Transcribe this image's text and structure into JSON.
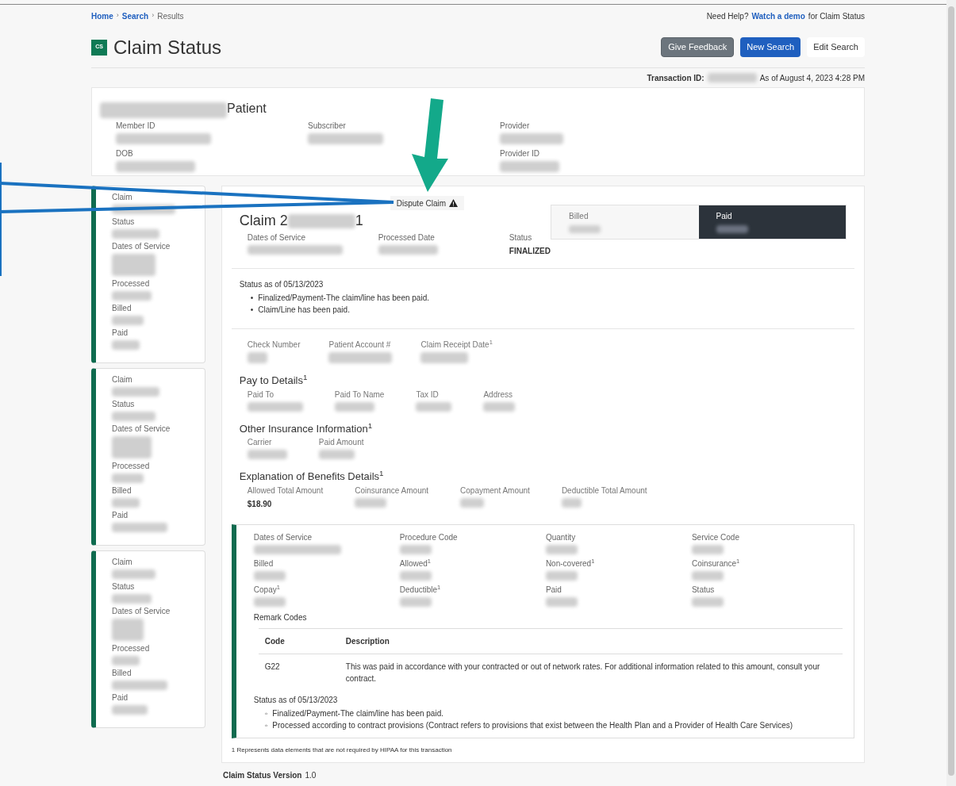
{
  "breadcrumb_separator": "›",
  "breadcrumb": [
    {
      "label": "Home",
      "link": true
    },
    {
      "label": "Search",
      "link": true
    },
    {
      "label": "Results",
      "link": false
    }
  ],
  "help": {
    "before": "Need Help?",
    "link": "Watch a demo",
    "after": "for Claim Status"
  },
  "header": {
    "logo": "CS",
    "title": "Claim Status",
    "buttons": [
      {
        "label": "Give Feedback",
        "kind": "secondary"
      },
      {
        "label": "New Search",
        "kind": "primary"
      },
      {
        "label": "Edit Search",
        "kind": "plain"
      }
    ]
  },
  "transaction": {
    "label": "Transaction ID:",
    "as_of": "As of August 4, 2023 4:28 PM"
  },
  "patient": {
    "title": "Patient",
    "columns": [
      [
        "Member ID",
        "DOB"
      ],
      [
        "Subscriber"
      ],
      [
        "Provider",
        "Provider ID"
      ]
    ]
  },
  "sidebar": {
    "cards": [
      {
        "fields": [
          "Claim",
          "Status",
          "Dates of Service",
          "Processed",
          "Billed",
          "Paid"
        ]
      },
      {
        "fields": [
          "Claim",
          "Status",
          "Dates of Service",
          "Processed",
          "Billed",
          "Paid"
        ]
      },
      {
        "fields": [
          "Claim",
          "Status",
          "Dates of Service",
          "Processed",
          "Billed",
          "Paid"
        ]
      }
    ]
  },
  "claim": {
    "action": "Dispute Claim",
    "title_start": "Claim 2",
    "title_end": "1",
    "meta": [
      {
        "label": "Dates of Service"
      },
      {
        "label": "Processed Date"
      },
      {
        "label": "Status",
        "value": "FINALIZED"
      }
    ],
    "totals": [
      {
        "label": "Billed",
        "dark": false
      },
      {
        "label": "Paid",
        "dark": true
      }
    ],
    "status_heading": "Status as of 05/13/2023",
    "status_marker": "•",
    "status_items": [
      "Finalized/Payment-The claim/line has been paid.",
      "Claim/Line has been paid."
    ],
    "check_fields": [
      "Check Number",
      "Patient Account #",
      "Claim Receipt Date$^{1}$"
    ],
    "sections": [
      {
        "title": "Pay to Details$^{1}$",
        "fields": [
          {
            "label": "Paid To"
          },
          {
            "label": "Paid To Name"
          },
          {
            "label": "Tax ID"
          },
          {
            "label": "Address"
          }
        ]
      },
      {
        "title": "Other Insurance Information$^{1}$",
        "fields": [
          {
            "label": "Carrier"
          },
          {
            "label": "Paid Amount"
          }
        ]
      },
      {
        "title": "Explanation of Benefits Details$^{1}$",
        "fields": [
          {
            "label": "Allowed Total Amount",
            "value": "$18.90"
          },
          {
            "label": "Coinsurance Amount"
          },
          {
            "label": "Copayment Amount"
          },
          {
            "label": "Deductible Total Amount"
          }
        ]
      }
    ],
    "line": {
      "fields": [
        "Dates of Service",
        "Procedure Code",
        "Quantity",
        "Service Code",
        "Billed",
        "Allowed$^{1}$",
        "Non-covered$^{1}$",
        "Coinsurance$^{1}$",
        "Copay$^{1}$",
        "Deductible$^{1}$",
        "Paid",
        "Status"
      ],
      "remark_title": "Remark Codes",
      "columns": [
        "Code",
        "Description"
      ],
      "rows": [
        {
          "code": "G22",
          "description": "This was paid in accordance with your contracted or out of network rates. For additional information related to this amount, consult your contract."
        }
      ],
      "status_heading": "Status as of 05/13/2023",
      "status_marker": "◦",
      "status_items": [
        "Finalized/Payment-The claim/line has been paid.",
        "Processed according to contract provisions (Contract refers to provisions that exist between the Health Plan and a Provider of Health Care Services)"
      ]
    },
    "footnote": "1 Represents data elements that are not required by HIPAA for this transaction"
  },
  "version": {
    "label": "Claim Status Version",
    "value": "1.0"
  }
}
